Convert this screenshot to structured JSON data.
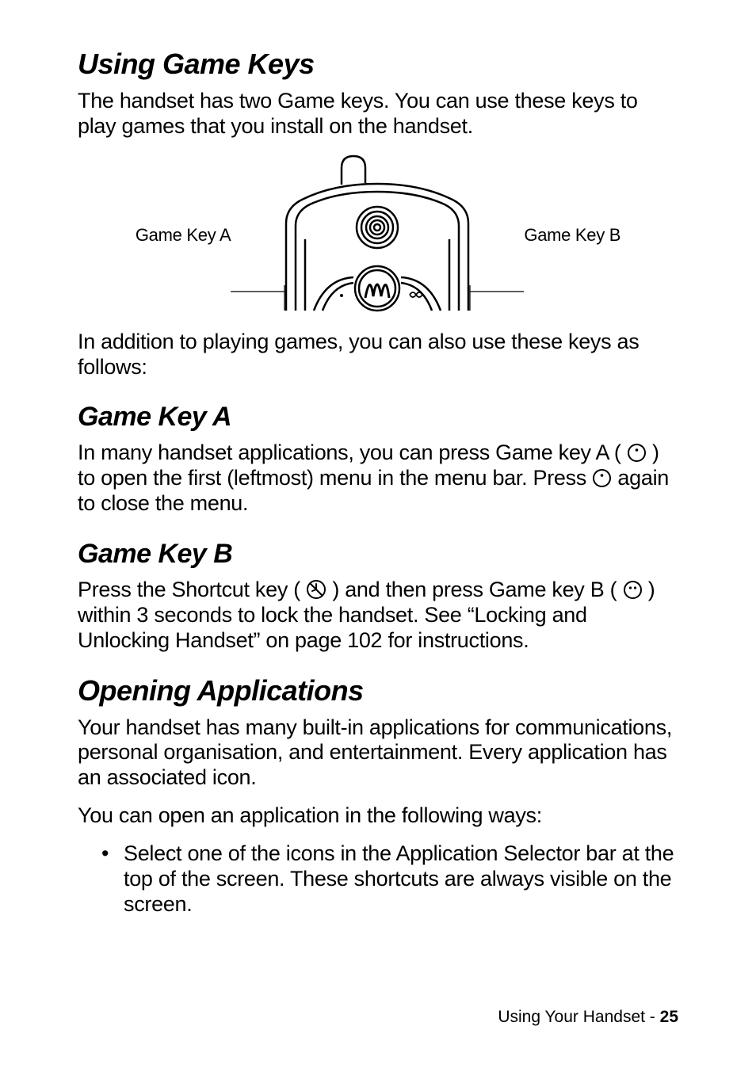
{
  "section1": {
    "heading": "Using Game Keys",
    "intro": "The handset has two Game keys. You can use these keys to play games that you install on the handset.",
    "figure": {
      "label_left": "Game Key A",
      "label_right": "Game Key B"
    },
    "after_figure": "In addition to playing games, you can also use these keys as follows:",
    "sub_a": {
      "heading": "Game Key A",
      "p1_part1": "In many handset applications, you can press Game key A (",
      "p1_part2": ") to open the first (leftmost) menu in the menu bar. Press ",
      "p1_part3": " again to close the menu."
    },
    "sub_b": {
      "heading": "Game Key B",
      "p1_part1": "Press the Shortcut key (",
      "p1_part2": ") and then press Game key B (",
      "p1_part3": ") within 3 seconds to lock the handset. See “Locking and Unlocking Handset” on page 102 for instructions."
    }
  },
  "section2": {
    "heading": "Opening Applications",
    "p1": "Your handset has many built-in applications for communications, personal organisation, and entertainment. Every application has an associated icon.",
    "p2": "You can open an application in the following ways:",
    "bullet1": "Select one of the icons in the Application Selector bar at the top of the screen. These shortcuts are always visible on the screen."
  },
  "footer": {
    "section": "Using Your Handset",
    "separator": " - ",
    "page": "25"
  }
}
